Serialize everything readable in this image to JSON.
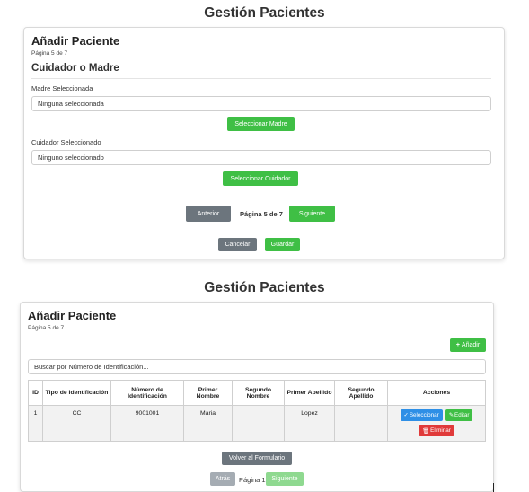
{
  "top": {
    "section_title": "Gestión Pacientes",
    "card_title": "Añadir Paciente",
    "page_note": "Página 5 de 7",
    "subheading": "Cuidador o Madre",
    "mother_label": "Madre Seleccionada",
    "mother_value": "Ninguna seleccionada",
    "select_mother_button": "Seleccionar Madre",
    "caregiver_label": "Cuidador Seleccionado",
    "caregiver_value": "Ninguno seleccionado",
    "select_caregiver_button": "Seleccionar Cuidador",
    "prev_button": "Anterior",
    "page_indicator": "Página 5 de 7",
    "next_button": "Siguiente",
    "cancel_button": "Cancelar",
    "save_button": "Guardar"
  },
  "bottom": {
    "section_title": "Gestión Pacientes",
    "card_title": "Añadir Paciente",
    "page_note": "Página 5 de 7",
    "add_button": "Añadir",
    "search_placeholder": "Buscar por Número de Identificación...",
    "table": {
      "columns": [
        "ID",
        "Tipo de Identificación",
        "Número de Identificación",
        "Primer Nombre",
        "Segundo Nombre",
        "Primer Apellido",
        "Segundo Apellido",
        "Acciones"
      ],
      "rows": [
        {
          "id": "1",
          "tipo": "CC",
          "numero": "9001001",
          "primer_nombre": "Maria",
          "segundo_nombre": "",
          "primer_apellido": "Lopez",
          "segundo_apellido": ""
        }
      ],
      "actions": {
        "select": "Seleccionar",
        "edit": "Editar",
        "delete": "Eliminar"
      }
    },
    "back_to_form_button": "Volver al Formulario",
    "prev_button": "Atrás",
    "page_indicator": "Página 1",
    "next_button": "Siguiente"
  }
}
